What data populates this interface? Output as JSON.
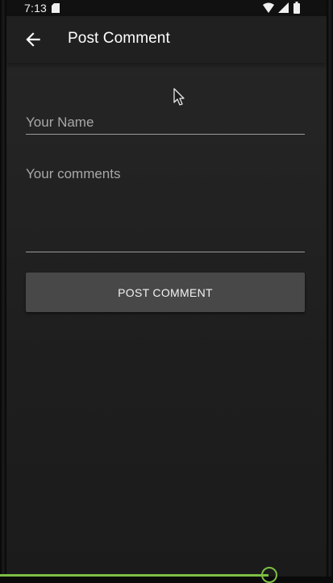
{
  "status_bar": {
    "time": "7:13",
    "icons": [
      "sd-card-icon",
      "wifi-icon",
      "signal-icon",
      "battery-icon"
    ]
  },
  "app_bar": {
    "back_icon": "arrow-left-icon",
    "title": "Post Comment"
  },
  "form": {
    "name_placeholder": "Your Name",
    "name_value": "",
    "comments_placeholder": "Your comments",
    "comments_value": "",
    "submit_label": "POST COMMENT"
  },
  "colors": {
    "background": "#232323",
    "app_bar": "#202020",
    "button": "#484848",
    "field_underline": "#9a9a9a",
    "progress_accent": "#7dbf45"
  }
}
